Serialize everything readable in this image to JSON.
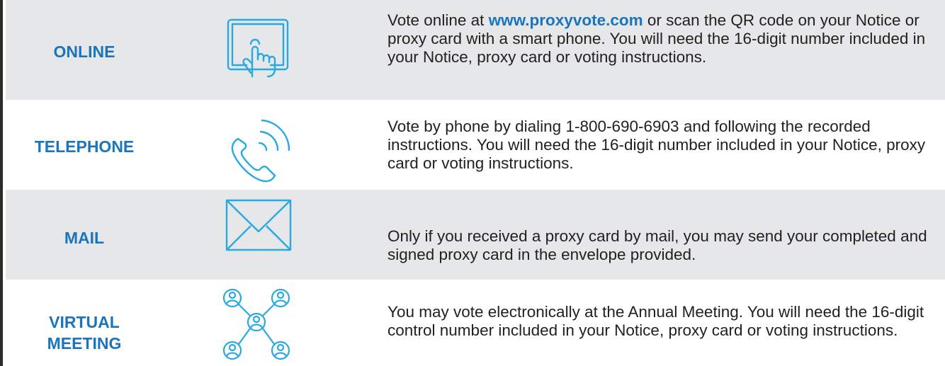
{
  "rows": [
    {
      "label": "ONLINE",
      "icon": "touchscreen-tap-icon",
      "description_before": "Vote online at ",
      "link_text": "www.proxyvote.com",
      "description_after": " or scan the QR code on your Notice or proxy card with a smart phone. You will need the 16-digit number included in your Notice, proxy card or voting instructions."
    },
    {
      "label": "TELEPHONE",
      "icon": "phone-icon",
      "description": "Vote by phone by dialing 1-800-690-6903 and following the recorded instructions. You will need the 16-digit number included in your Notice, proxy card or voting instructions."
    },
    {
      "label": "MAIL",
      "icon": "envelope-icon",
      "description": "Only if you received a proxy card by mail, you may send your completed and signed proxy card in the envelope provided."
    },
    {
      "label_line1": "VIRTUAL",
      "label_line2": "MEETING",
      "icon": "people-network-icon",
      "description": "You may vote electronically at the Annual Meeting.  You will need the 16-digit control number included in your Notice, proxy card or voting instructions."
    }
  ],
  "colors": {
    "accent_blue": "#1b75bc",
    "icon_blue": "#29a9e1",
    "row_grey": "#e6e7e8",
    "text": "#231f20"
  }
}
